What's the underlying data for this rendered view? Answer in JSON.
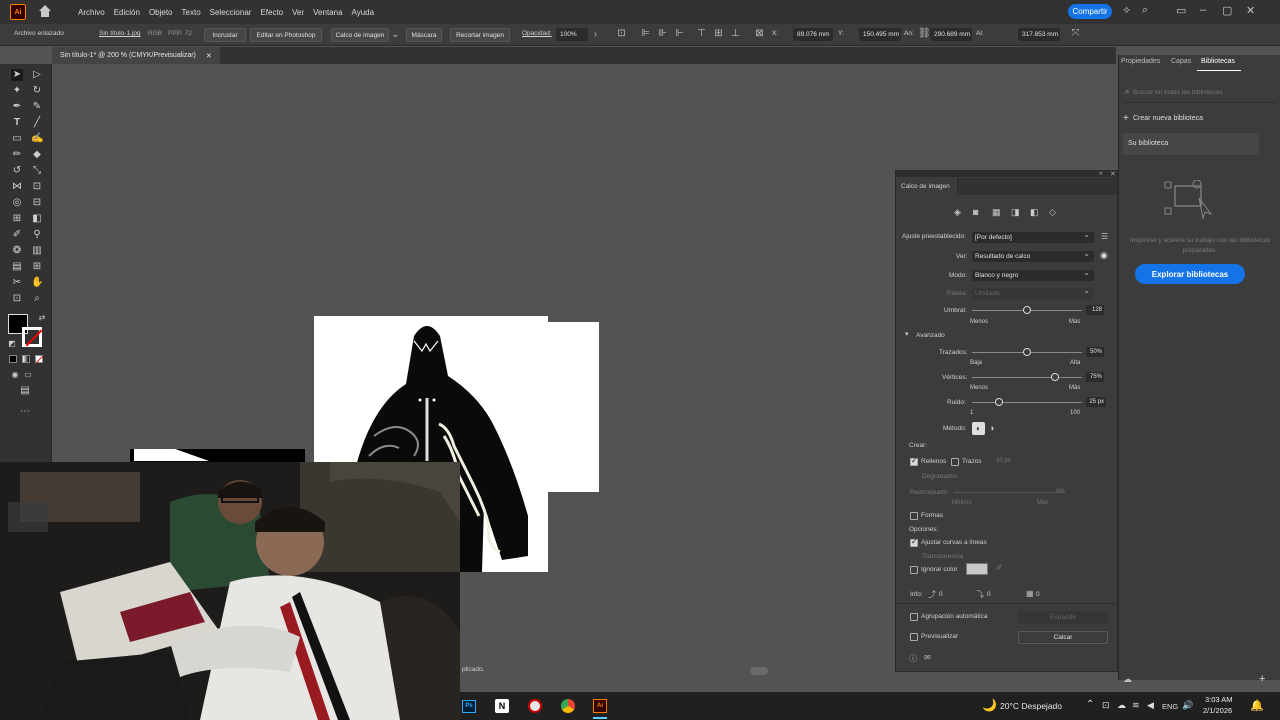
{
  "menubar": {
    "app_logo": "Ai",
    "items": [
      "Archivo",
      "Edición",
      "Objeto",
      "Texto",
      "Seleccionar",
      "Efecto",
      "Ver",
      "Ventana",
      "Ayuda"
    ],
    "share_label": "Compartir"
  },
  "controlbar": {
    "linked_file": "Archivo enlazado",
    "filename": "Sin título-1.jpg",
    "color_mode": "RGB",
    "ppp": "PPP: 72",
    "embed_label": "Incrustar",
    "edit_photoshop_label": "Editar en Photoshop",
    "image_trace_label": "Calco de imagen",
    "mask_label": "Máscara",
    "crop_label": "Recortar imagen",
    "opacity_label": "Opacidad:",
    "opacity_value": "100%",
    "x_label": "X:",
    "x_value": "89.076 mm",
    "y_label": "Y:",
    "y_value": "150.495 mm",
    "w_label": "An:",
    "w_value": "290.689 mm",
    "h_label": "Al:",
    "h_value": "317.853 mm"
  },
  "document": {
    "tab_title": "Sin título-1* @ 200 % (CMYK/Previsualizar)",
    "status_text": "plicado."
  },
  "right_panel": {
    "tabs": [
      "Propiedades",
      "Capas",
      "Bibliotecas"
    ],
    "active_tab": "Bibliotecas",
    "search_placeholder": "Buscar en todas las bibliotecas",
    "create_library": "Crear nueva biblioteca",
    "your_library": "Su biblioteca",
    "inspire_text": "Inspírese y acelere su trabajo con las bibliotecas preparadas.",
    "explore_button": "Explorar bibliotecas"
  },
  "trace_panel": {
    "title": "Calco de imagen",
    "preset_label": "Ajuste preestablecido:",
    "preset_value": "[Por defecto]",
    "view_label": "Ver:",
    "view_value": "Resultado de calco",
    "mode_label": "Modo:",
    "mode_value": "Blanco y negro",
    "palette_label": "Paleta:",
    "palette_value": "Limitado",
    "threshold_label": "Umbral:",
    "threshold_value": "128",
    "threshold_min": "Menos",
    "threshold_max": "Más",
    "advanced_label": "Avanzado",
    "paths_label": "Trazados:",
    "paths_value": "50%",
    "paths_min": "Baja",
    "paths_max": "Alta",
    "corners_label": "Vértices:",
    "corners_value": "75%",
    "corners_min": "Menos",
    "corners_max": "Más",
    "noise_label": "Ruido:",
    "noise_value": "25 px",
    "noise_min": "1",
    "noise_max": "100",
    "method_label": "Método:",
    "create_label": "Crear:",
    "fills_label": "Rellenos",
    "strokes_label": "Trazos",
    "stroke_value": "10 px",
    "gradients_label": "Degradados",
    "rounded_label": "Redondeado:",
    "rounded_value": "0%",
    "rounded_min": "Mínimo",
    "rounded_max": "Más",
    "shapes_label": "Formas",
    "options_label": "Opciones:",
    "snap_label": "Ajustar curvas a líneas",
    "transparency_label": "Transparencia",
    "ignore_color_label": "Ignorar color",
    "info_label": "Info:",
    "info_paths": "0",
    "info_anchors": "0",
    "info_colors": "0",
    "auto_group_label": "Agrupación automática",
    "expand_label": "Expandir",
    "preview_label": "Previsualizar",
    "trace_button": "Calcar"
  },
  "taskbar": {
    "weather": "20°C Despejado",
    "lang": "ENG",
    "time": "3:03 AM",
    "date": "2/1/2026"
  },
  "colors": {
    "accent": "#1473e6",
    "ai_orange": "#ff7c00"
  }
}
